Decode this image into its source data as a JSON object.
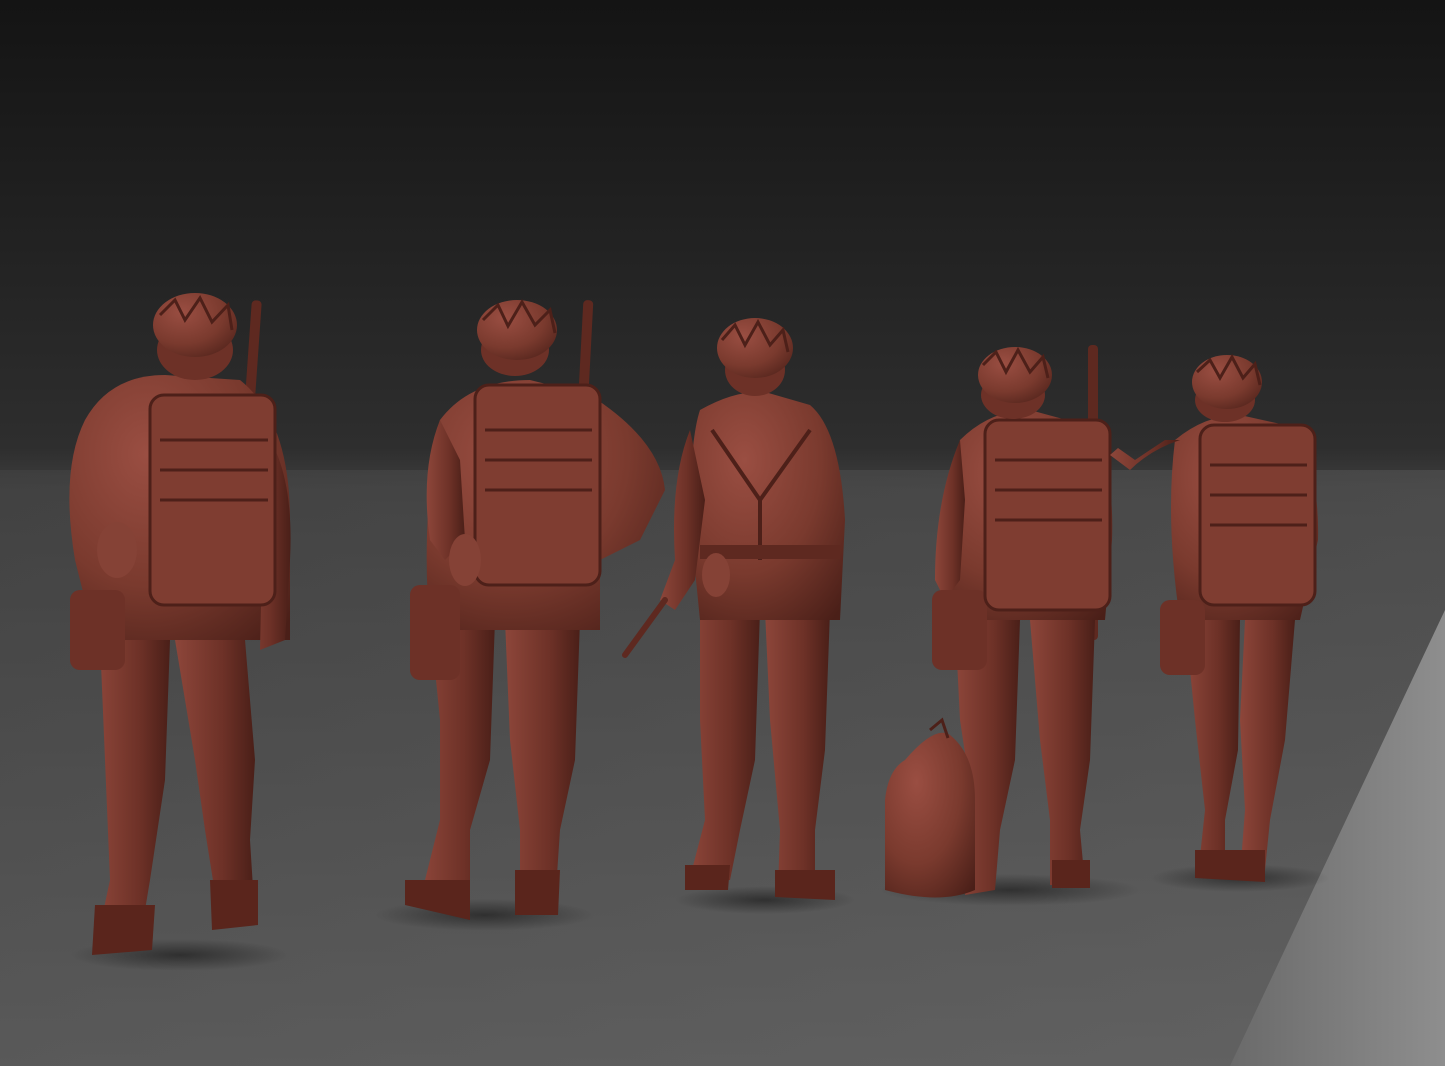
{
  "scene": {
    "background_top": "#161616",
    "background_horizon": "#3a3a3a",
    "floor_near": "#6a6a6a",
    "floor_far": "#4a4a4a",
    "highlight_strip": "#8a8a8a",
    "clay_color": "#7a3a2e",
    "clay_shadow": "#4e211a",
    "clay_highlight": "#a0554a"
  },
  "figures": [
    {
      "id": "figure-1",
      "pose": "walking-back-view",
      "gear": [
        "helmet-with-netting",
        "backpack",
        "rifle",
        "canteen",
        "side-pouch"
      ]
    },
    {
      "id": "figure-2",
      "pose": "standing-hand-on-hip",
      "gear": [
        "helmet-with-netting",
        "backpack",
        "rifle",
        "canteen",
        "side-pouch"
      ]
    },
    {
      "id": "figure-3",
      "pose": "standing-holding-stick",
      "gear": [
        "helmet-with-netting",
        "suspenders",
        "canteen",
        "stick"
      ]
    },
    {
      "id": "figure-4",
      "pose": "standing-with-duffel",
      "gear": [
        "helmet-with-netting",
        "backpack",
        "rifle",
        "side-pouch",
        "duffel-bag"
      ]
    },
    {
      "id": "figure-5",
      "pose": "pointing-forward",
      "gear": [
        "helmet-with-netting",
        "backpack",
        "side-pouch"
      ]
    }
  ]
}
